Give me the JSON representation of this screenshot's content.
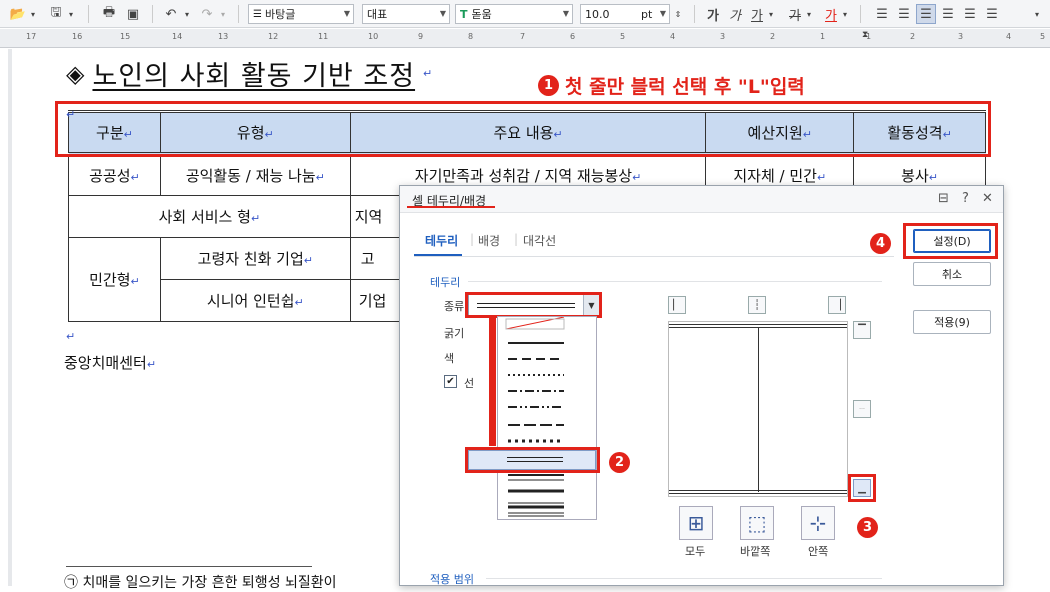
{
  "toolbar": {
    "style_value": "바탕글",
    "font_lang_value": "대표",
    "font_icon": "T",
    "font_value": "돋움",
    "size_value": "10.0",
    "size_unit": "pt",
    "fmt_bold": "가",
    "fmt_italic": "가",
    "fmt_underline": "가",
    "fmt_strike": "가",
    "fmt_color": "가"
  },
  "ruler": {
    "numbers": [
      "17",
      "16",
      "15",
      "14",
      "13",
      "12",
      "11",
      "10",
      "9",
      "8",
      "7",
      "6",
      "5",
      "4",
      "3",
      "2",
      "1",
      "1",
      "2",
      "3",
      "4",
      "5"
    ]
  },
  "document": {
    "title": "노인의 사회 활동 기반 조정",
    "title_mark": "◈",
    "table": {
      "header": [
        "구분",
        "유형",
        "주요 내용",
        "예산지원",
        "활동성격"
      ],
      "rows": [
        [
          "공공성",
          "공익활동 / 재능 나눔",
          "자기만족과 성취감 / 지역 재능봉상",
          "지자체 / 민간",
          "봉사"
        ],
        [
          "사회 서비스 형",
          "지역"
        ],
        [
          "민간형",
          "고령자 친화 기업",
          "고"
        ],
        [
          "시니어 인턴쉽",
          "기업"
        ]
      ]
    },
    "text_line": "중앙치매센터",
    "footer_text": "㉠ 치매를 일으키는 가장 흔한 퇴행성 뇌질환이"
  },
  "annotations": {
    "step1_num": "1",
    "step1_text": "첫 줄만 블럭 선택 후 \"L\"입력",
    "step2_num": "2",
    "step3_num": "3",
    "step4_num": "4",
    "color": "#e2231a"
  },
  "dialog": {
    "title": "셀 테두리/배경",
    "tabs": [
      "테두리",
      "배경",
      "대각선"
    ],
    "section_border": "테두리",
    "label_type": "종류",
    "label_width": "굵기",
    "label_color": "색",
    "checkbox_label": "선",
    "section_apply": "적용 범위",
    "btn_all": "모두",
    "btn_outer": "바깥쪽",
    "btn_inner": "안쪽",
    "btn_set": "설정(D)",
    "btn_cancel": "취소",
    "btn_apply": "적용(9)",
    "help_icon": "?",
    "close_icon": "✕"
  }
}
